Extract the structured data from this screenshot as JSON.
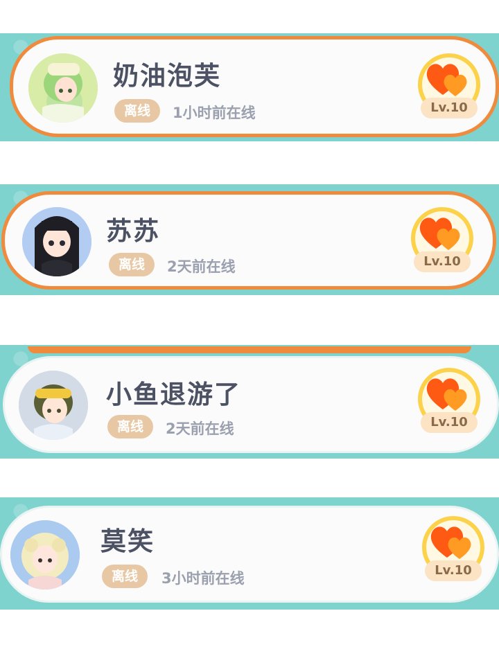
{
  "friends": [
    {
      "name": "奶油泡芙",
      "status": "离线",
      "last_seen": "1小时前在线",
      "level": "Lv.10",
      "avatar": "green-hair-avatar"
    },
    {
      "name": "苏苏",
      "status": "离线",
      "last_seen": "2天前在线",
      "level": "Lv.10",
      "avatar": "black-hair-avatar"
    },
    {
      "name": "小鱼退游了",
      "status": "离线",
      "last_seen": "2天前在线",
      "level": "Lv.10",
      "avatar": "goggles-avatar"
    },
    {
      "name": "莫笑",
      "status": "离线",
      "last_seen": "3小时前在线",
      "level": "Lv.10",
      "avatar": "blonde-curls-avatar"
    }
  ],
  "colors": {
    "selected_border": "#f08a3c",
    "band": "#7fd3cf",
    "badge": "#e8c8a4",
    "heart": "#ff6a1a",
    "ring": "#fbd24a"
  }
}
